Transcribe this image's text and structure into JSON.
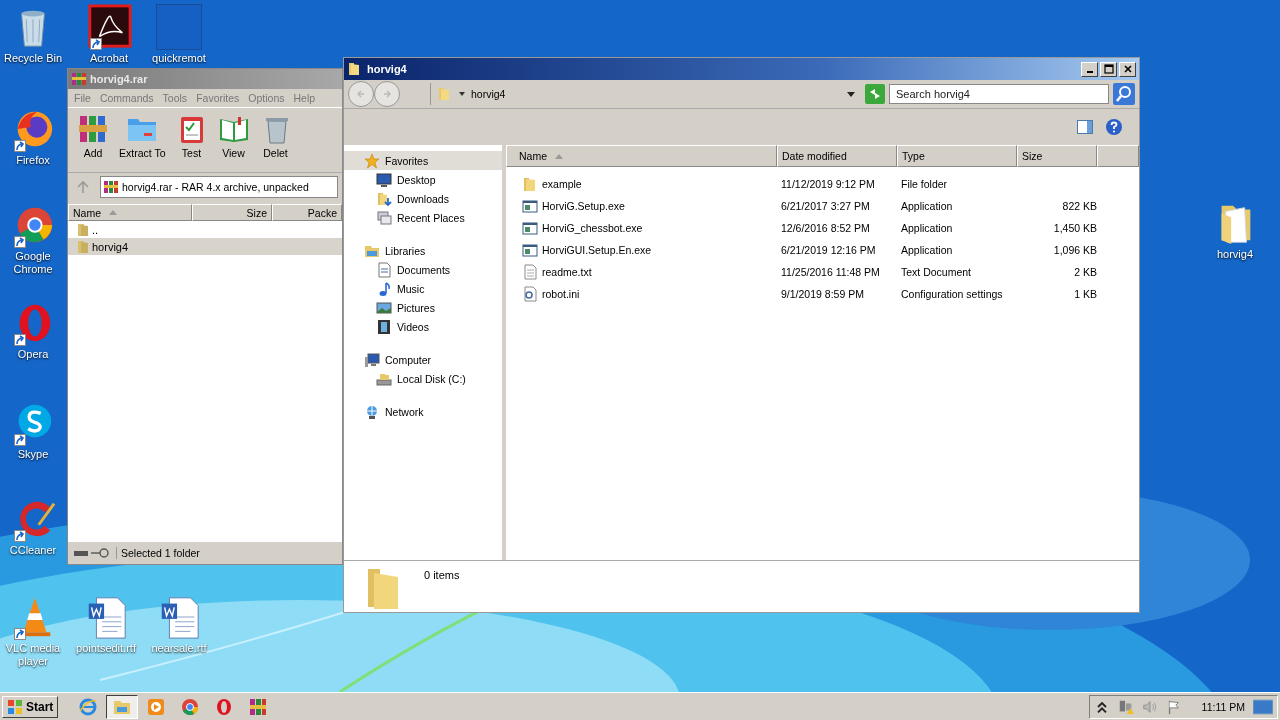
{
  "desktop_icons": [
    {
      "label": "Recycle Bin",
      "kind": "recycle",
      "shortcut": false
    },
    {
      "label": "Acrobat",
      "kind": "acrobat",
      "shortcut": true
    },
    {
      "label": "quickremot",
      "kind": "blank",
      "shortcut": false
    },
    {
      "label": "Firefox",
      "kind": "firefox",
      "shortcut": true
    },
    {
      "label": "Google Chrome",
      "kind": "chrome",
      "shortcut": true
    },
    {
      "label": "Opera",
      "kind": "opera",
      "shortcut": true
    },
    {
      "label": "Skype",
      "kind": "skype",
      "shortcut": true
    },
    {
      "label": "CCleaner",
      "kind": "ccleaner",
      "shortcut": true
    },
    {
      "label": "VLC media player",
      "kind": "vlc",
      "shortcut": true
    },
    {
      "label": "pointsedit.rtf",
      "kind": "doc",
      "shortcut": false
    },
    {
      "label": "nearsale.rtf",
      "kind": "doc",
      "shortcut": false
    },
    {
      "label": "horvig4",
      "kind": "folder",
      "shortcut": false
    }
  ],
  "winrar": {
    "title": "horvig4.rar",
    "menu": [
      "File",
      "Commands",
      "Tools",
      "Favorites",
      "Options",
      "Help"
    ],
    "toolbar": [
      {
        "label": "Add",
        "kind": "add"
      },
      {
        "label": "Extract To",
        "kind": "extract"
      },
      {
        "label": "Test",
        "kind": "test"
      },
      {
        "label": "View",
        "kind": "view"
      },
      {
        "label": "Delet",
        "kind": "delete"
      }
    ],
    "path": "horvig4.rar - RAR 4.x archive, unpacked",
    "columns": [
      "Name",
      "Size",
      "Packe"
    ],
    "rows": [
      {
        "name": "..",
        "selected": false
      },
      {
        "name": "horvig4",
        "selected": true
      }
    ],
    "status": "Selected 1 folder"
  },
  "explorer": {
    "title": "horvig4",
    "address": "horvig4",
    "search": {
      "placeholder": "Search horvig4"
    },
    "nav": [
      {
        "label": "Favorites",
        "kind": "star",
        "selected": true,
        "children": [
          {
            "label": "Desktop",
            "kind": "desktop",
            "selected": false
          },
          {
            "label": "Downloads",
            "kind": "downloads",
            "selected": false
          },
          {
            "label": "Recent Places",
            "kind": "recent",
            "selected": false
          }
        ]
      },
      {
        "label": "Libraries",
        "kind": "libraries",
        "selected": false,
        "children": [
          {
            "label": "Documents",
            "kind": "documents",
            "selected": false
          },
          {
            "label": "Music",
            "kind": "music",
            "selected": false
          },
          {
            "label": "Pictures",
            "kind": "pictures",
            "selected": false
          },
          {
            "label": "Videos",
            "kind": "videos",
            "selected": false
          }
        ]
      },
      {
        "label": "Computer",
        "kind": "computer",
        "selected": false,
        "children": [
          {
            "label": "Local Disk (C:)",
            "kind": "disk",
            "selected": false
          }
        ]
      },
      {
        "label": "Network",
        "kind": "network",
        "selected": false
      }
    ],
    "columns": [
      "Name",
      "Date modified",
      "Type",
      "Size"
    ],
    "files": [
      {
        "name": "example",
        "date": "11/12/2019 9:12 PM",
        "type": "File folder",
        "kind": "folder"
      },
      {
        "name": "HorviG.Setup.exe",
        "date": "6/21/2017 3:27 PM",
        "type": "Application",
        "size": "822 KB",
        "kind": "exe"
      },
      {
        "name": "HorviG_chessbot.exe",
        "date": "12/6/2016 8:52 PM",
        "type": "Application",
        "size": "1,450 KB",
        "kind": "exe"
      },
      {
        "name": "HorviGUI.Setup.En.exe",
        "date": "6/21/2019 12:16 PM",
        "type": "Application",
        "size": "1,096 KB",
        "kind": "exe"
      },
      {
        "name": "readme.txt",
        "date": "11/25/2016 11:48 PM",
        "type": "Text Document",
        "size": "2 KB",
        "kind": "txt"
      },
      {
        "name": "robot.ini",
        "date": "9/1/2019 8:59 PM",
        "type": "Configuration settings",
        "size": "1 KB",
        "kind": "ini"
      }
    ],
    "details": "0 items"
  },
  "taskbar": {
    "start": "Start",
    "items": [
      {
        "kind": "ie",
        "selected": false
      },
      {
        "kind": "explorer",
        "selected": true
      },
      {
        "kind": "media",
        "selected": false
      },
      {
        "kind": "chrome",
        "selected": false
      },
      {
        "kind": "opera",
        "selected": false
      },
      {
        "kind": "winrar",
        "selected": false
      }
    ],
    "clock": "11:11 PM"
  }
}
